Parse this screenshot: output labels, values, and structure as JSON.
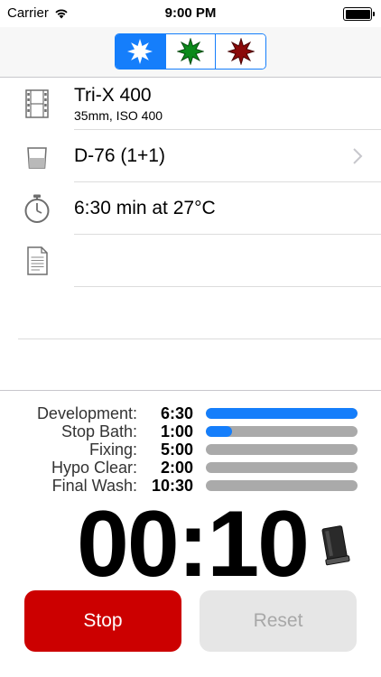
{
  "status_bar": {
    "carrier": "Carrier",
    "time": "9:00 PM",
    "battery_level": 1.0
  },
  "light_modes": [
    {
      "name": "white-light",
      "color": "#ffffff",
      "active": true
    },
    {
      "name": "green-light",
      "color": "#0a8a1a",
      "active": false
    },
    {
      "name": "red-light",
      "color": "#8b0a0a",
      "active": false
    }
  ],
  "film": {
    "title": "Tri-X 400",
    "subtitle": "35mm, ISO 400",
    "icon": "film-strip-icon"
  },
  "developer": {
    "title": "D-76 (1+1)",
    "icon": "beaker-icon"
  },
  "duration": {
    "title": "6:30 min at 27°C",
    "icon": "stopwatch-icon"
  },
  "notes": {
    "title": "",
    "icon": "document-icon"
  },
  "steps": [
    {
      "name": "Development:",
      "time": "6:30",
      "progress": 1.0
    },
    {
      "name": "Stop Bath:",
      "time": "1:00",
      "progress": 0.17
    },
    {
      "name": "Fixing:",
      "time": "5:00",
      "progress": 0
    },
    {
      "name": "Hypo Clear:",
      "time": "2:00",
      "progress": 0
    },
    {
      "name": "Final Wash:",
      "time": "10:30",
      "progress": 0
    }
  ],
  "timer": {
    "value": "00:10",
    "icon": "developing-tank-icon"
  },
  "buttons": {
    "stop": "Stop",
    "reset": "Reset"
  },
  "colors": {
    "accent": "#157efb",
    "stop": "#cc0000",
    "disabled": "#e6e6e6"
  }
}
